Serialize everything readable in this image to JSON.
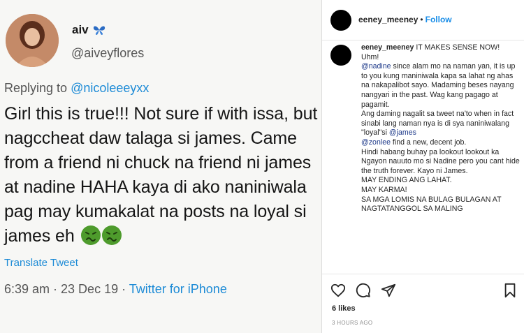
{
  "tweet": {
    "display_name": "aiv",
    "handle": "@aiveyflores",
    "replying_to_prefix": "Replying to ",
    "replying_to_handle": "@nicoleeeyxx",
    "body": "Girl this is true!!! Not sure if with issa, but nagccheat daw talaga si james. Came from a friend ni chuck na friend ni james at nadine HAHA kaya di ako naniniwala pag may kumakalat na posts na loyal si james eh",
    "emoji": [
      "nauseated-face-icon",
      "nauseated-face-icon"
    ],
    "translate_label": "Translate Tweet",
    "timestamp": "6:39 am · 23 Dec 19 · ",
    "source": "Twitter for iPhone",
    "colors": {
      "link": "#1d8bd6",
      "text": "#151515",
      "muted": "#555555"
    }
  },
  "instagram": {
    "header": {
      "username": "eeney_meeney",
      "separator": "•",
      "follow_label": "Follow"
    },
    "comment": {
      "username": "eeney_meeney",
      "line_1": " IT MAKES SENSE NOW!",
      "line_2": "Uhm!",
      "mention_nadine": "@nadine",
      "para_1": " since alam mo na naman yan, it is up to you kung maniniwala kapa sa lahat ng ahas na nakapalibot sayo. Madaming beses nayang nangyari in the past. Wag kang pagago at pagamit.",
      "para_2_start": "Ang daming nagalit sa tweet na'to when in fact sinabi lang naman nya is di sya naniniwalang \"loyal\"si ",
      "mention_james": "@james",
      "mention_zonlee": "@zonlee",
      "para_2_end": " find a new, decent job.",
      "line_3": "Hindi habang buhay pa lookout lookout ka",
      "line_4": "Ngayon nauuto mo si Nadine pero you cant hide the truth forever. Kayo ni James.",
      "line_5": "MAY ENDING ANG LAHAT.",
      "line_6": "MAY KARMA!",
      "line_7": "SA MGA LOMIS NA BULAG BULAGAN AT NAGTATANGGOL SA MALING"
    },
    "likes": "6 likes",
    "time_ago": "3 HOURS AGO",
    "icons": [
      "heart-icon",
      "comment-icon",
      "share-icon",
      "bookmark-icon"
    ],
    "colors": {
      "follow": "#1a8ee8",
      "mention": "#1e3a8a",
      "muted": "#8e8e8e"
    }
  }
}
